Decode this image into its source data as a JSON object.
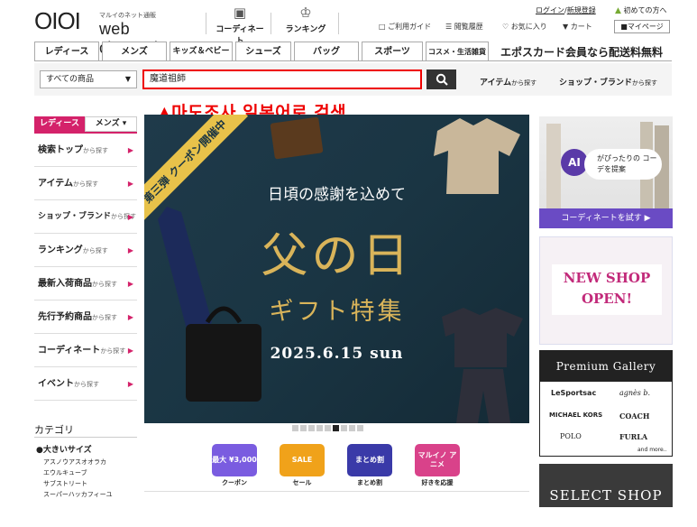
{
  "header": {
    "logo_mark": "OIOI",
    "logo_tagline": "マルイのネット通販",
    "logo_text": "web channel",
    "coordinate_label": "コーディネート",
    "ranking_label": "ランキング",
    "login": "ログイン",
    "register": "新規登録",
    "separator": "/",
    "first_time": "初めての方へ",
    "guide": "ご利用ガイド",
    "history": "閲覧履歴",
    "favorites": "お気に入り",
    "cart": "カート",
    "mypage": "マイページ"
  },
  "categories": [
    "レディース",
    "メンズ",
    "キッズ＆ベビー",
    "シューズ",
    "バッグ",
    "スポーツ",
    "コスメ・生活雑貨"
  ],
  "epos_promo": "エポスカード会員なら配送料無料",
  "search": {
    "scope": "すべての商品",
    "query": "魔道祖師",
    "item_search": "アイテム",
    "shop_search": "ショップ・ブランド",
    "from_suffix": "から探す"
  },
  "annotation": "▲마도조사 일본어로 검색",
  "sidebar": {
    "tab_ladies": "レディース",
    "tab_mens": "メンズ ▾",
    "items": [
      {
        "main": "検索トップ",
        "sub": "から探す"
      },
      {
        "main": "アイテム",
        "sub": "から探す"
      },
      {
        "main": "ショップ・ブランド",
        "sub": "から探す"
      },
      {
        "main": "ランキング",
        "sub": "から探す"
      },
      {
        "main": "最新入荷商品",
        "sub": "から探す"
      },
      {
        "main": "先行予約商品",
        "sub": "から探す"
      },
      {
        "main": "コーディネート",
        "sub": "から探す"
      },
      {
        "main": "イベント",
        "sub": "から探す"
      }
    ],
    "category_title": "カテゴリ",
    "big_size": "大きいサイズ",
    "sub_items": [
      "アスノウアスオオラカ",
      "エウルキューブ",
      "サブストリート",
      "スーパーハッカフィーユ"
    ]
  },
  "banner": {
    "ribbon": "第三弾 クーポン開催中",
    "thanks": "日頃の感謝を込めて",
    "title": "父の日",
    "subtitle": "ギフト特集",
    "date": "2025.6.15 sun"
  },
  "quick_icons": [
    {
      "label": "クーポン",
      "icon_text": "最大 ¥3,000",
      "color": "#7a5ce0"
    },
    {
      "label": "セール",
      "icon_text": "SALE",
      "color": "#f0a21a"
    },
    {
      "label": "まとめ割",
      "icon_text": "まとめ割",
      "color": "#3a3aa8"
    },
    {
      "label": "好きを応援",
      "icon_text": "マルイノ アニメ",
      "color": "#d9428a"
    }
  ],
  "right": {
    "ai_badge": "AI",
    "ai_text": "がぴったりの コーデを提案",
    "ai_button": "コーディネートを試す ▶",
    "new_shop": "NEW SHOP OPEN!",
    "premium_title": "Premium Gallery",
    "brands": [
      "LeSportsac",
      "agnès b.",
      "MICHAEL KORS",
      "COACH",
      "POLO",
      "FURLA",
      "and more.."
    ],
    "select_shop": "SELECT SHOP"
  }
}
